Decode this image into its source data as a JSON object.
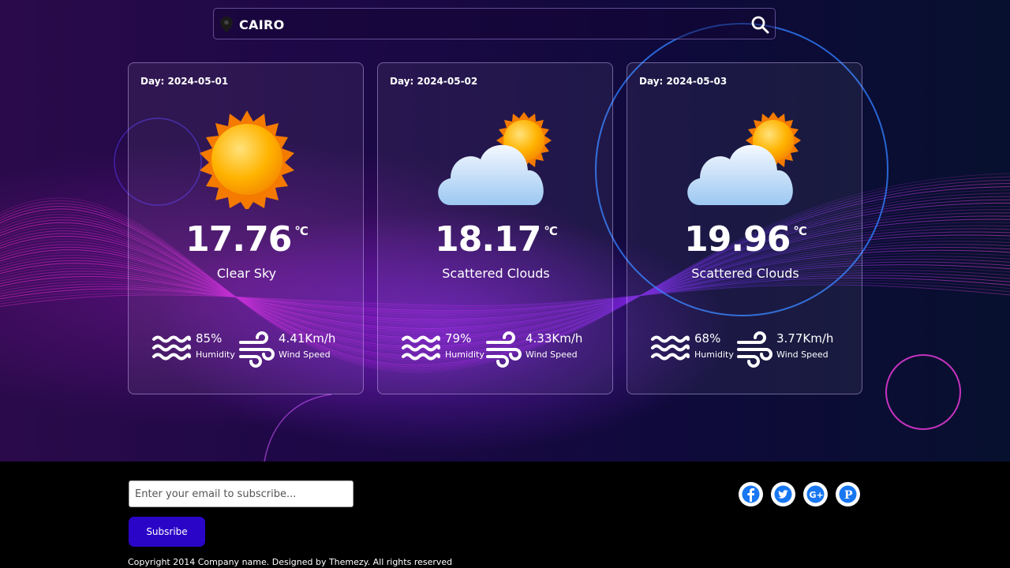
{
  "search": {
    "city": "CAIRO",
    "placeholder": ""
  },
  "forecast": [
    {
      "day": "Day: 2024-05-01",
      "temp": "17.76",
      "unit": "°C",
      "condition": "Clear Sky",
      "icon": "sun-icon",
      "humidity": "85%",
      "humidity_label": "Humidity",
      "wind": "4.41Km/h",
      "wind_label": "Wind Speed"
    },
    {
      "day": "Day: 2024-05-02",
      "temp": "18.17",
      "unit": "°C",
      "condition": "Scattered Clouds",
      "icon": "cloud-sun-icon",
      "humidity": "79%",
      "humidity_label": "Humidity",
      "wind": "4.33Km/h",
      "wind_label": "Wind Speed"
    },
    {
      "day": "Day: 2024-05-03",
      "temp": "19.96",
      "unit": "°C",
      "condition": "Scattered Clouds",
      "icon": "cloud-sun-icon",
      "humidity": "68%",
      "humidity_label": "Humidity",
      "wind": "3.77Km/h",
      "wind_label": "Wind Speed"
    }
  ],
  "footer": {
    "email_placeholder": "Enter your email to subscribe...",
    "subscribe_label": "Subsribe",
    "social": [
      "facebook-icon",
      "twitter-icon",
      "google-plus-icon",
      "pinterest-icon"
    ],
    "copyright": "Copyright 2014 Company name. Designed by Themezy. All rights reserved"
  },
  "colors": {
    "social_blue": "#1877f2",
    "subscribe_button": "#2a05c8",
    "sun": "#ffb300"
  }
}
